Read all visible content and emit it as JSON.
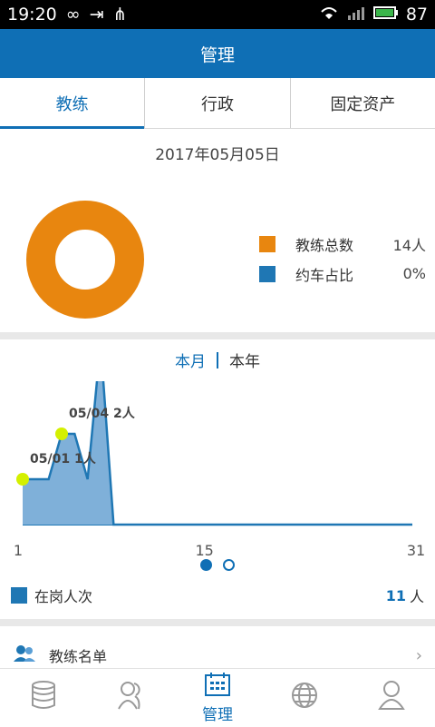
{
  "status": {
    "time": "19:20",
    "battery": "87"
  },
  "header": {
    "title": "管理"
  },
  "tabs": [
    {
      "label": "教练",
      "active": true
    },
    {
      "label": "行政",
      "active": false
    },
    {
      "label": "固定资产",
      "active": false
    }
  ],
  "date": "2017年05月05日",
  "legend": [
    {
      "label": "教练总数",
      "value": "14人",
      "color": "#e8860f"
    },
    {
      "label": "约车占比",
      "value": "0%",
      "color": "#1f77b4"
    }
  ],
  "period": {
    "month": "本月",
    "year": "本年"
  },
  "chart_data": {
    "type": "area",
    "x": [
      1,
      2,
      3,
      4,
      5,
      6,
      7,
      8,
      9,
      31
    ],
    "values": [
      1,
      1,
      1,
      2,
      2,
      1,
      4,
      0,
      0,
      0
    ],
    "xticks": [
      "1",
      "15",
      "31"
    ],
    "annotations": [
      {
        "label": "05/01 1人",
        "x": 1,
        "y": 1
      },
      {
        "label": "05/04 2人",
        "x": 4,
        "y": 2
      }
    ],
    "ylim": [
      0,
      3
    ],
    "xlim": [
      1,
      31
    ]
  },
  "summary": {
    "label": "在岗人次",
    "value": "11",
    "unit": "人"
  },
  "list": {
    "item_label": "教练名单"
  },
  "bottomnav": {
    "manage_label": "管理"
  }
}
